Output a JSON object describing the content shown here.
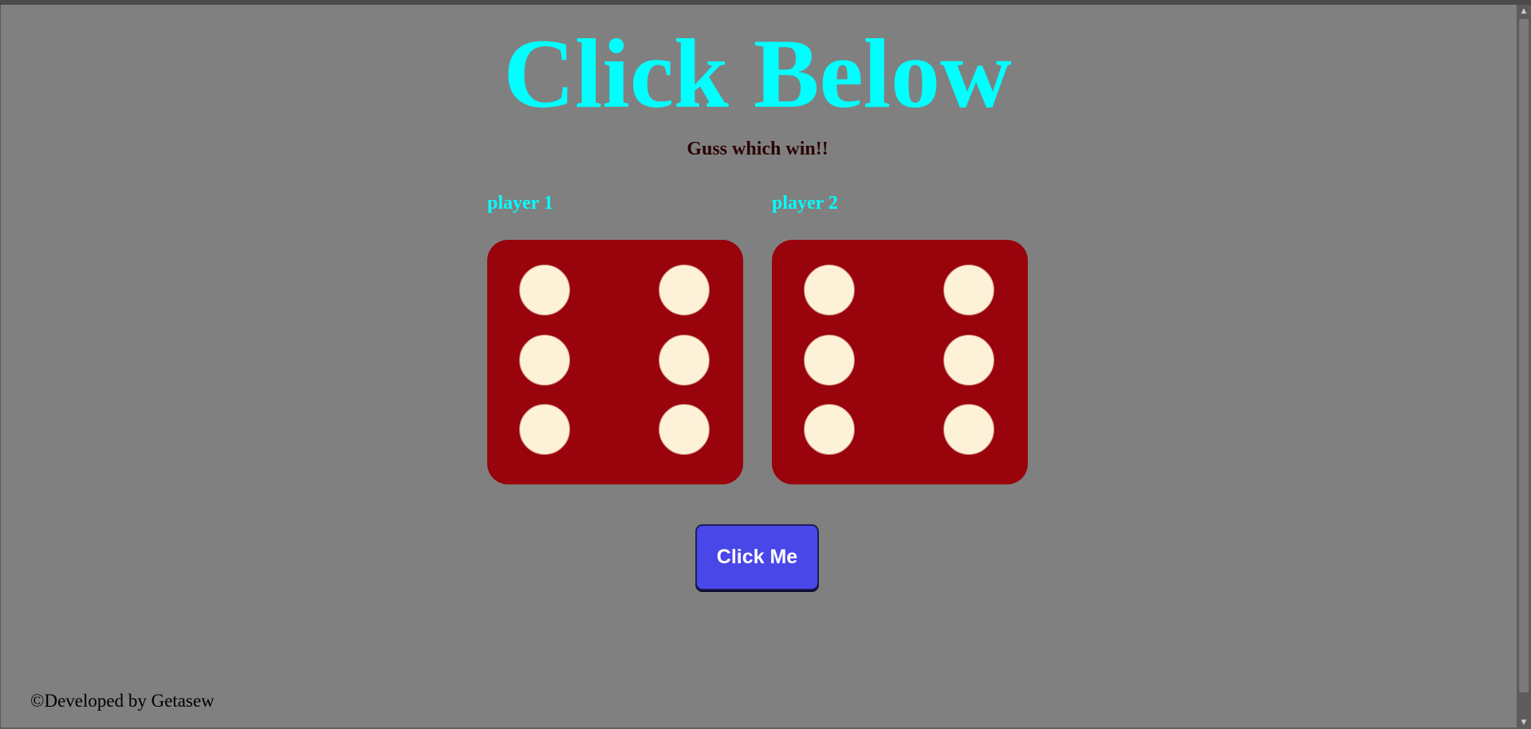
{
  "title": "Click Below",
  "subtitle": "Guss which win!!",
  "players": [
    {
      "label": "player 1",
      "die_value": 6
    },
    {
      "label": "player 2",
      "die_value": 6
    }
  ],
  "button": {
    "label": "Click Me"
  },
  "footer": "©Developed by Getasew",
  "colors": {
    "background": "#808080",
    "title": "#00ffff",
    "subtitle": "#2a0000",
    "die_face": "#99030b",
    "pip": "#fdf1d8",
    "button": "#4a47e8"
  },
  "icons": {
    "scroll_up": "scroll-up-arrow-icon",
    "scroll_down": "scroll-down-arrow-icon"
  }
}
